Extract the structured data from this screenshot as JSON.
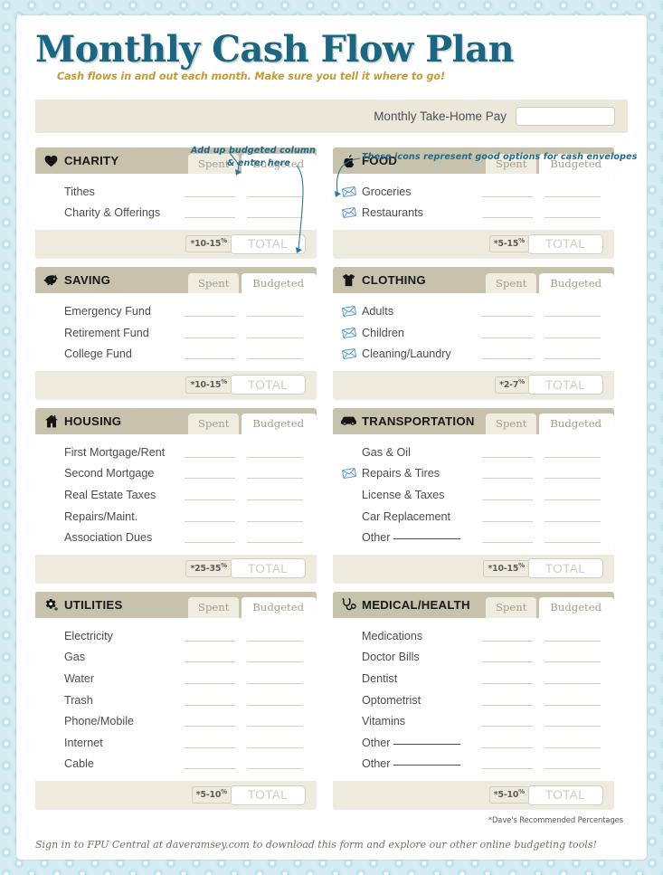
{
  "header": {
    "title": "Monthly Cash Flow Plan",
    "subtitle": "Cash flows in and out each month. Make sure you tell it where to go!",
    "takehome_label": "Monthly Take-Home Pay",
    "takehome_value": ""
  },
  "columns": {
    "spent": "Spent",
    "budgeted": "Budgeted",
    "total": "TOTAL"
  },
  "annotations": {
    "add_up": "Add up budgeted column",
    "enter_here": "& enter here",
    "icons_note": "These icons represent good options for cash envelopes"
  },
  "notes": {
    "recommended": "*Dave's Recommended Percentages",
    "signin": "Sign in to FPU Central at daveramsey.com to download this form and explore our other online budgeting tools!"
  },
  "colors": {
    "title": "#1b6683",
    "subtitle": "#c59a33",
    "header_bar": "#c7c2ab",
    "footer_bar": "#edeade",
    "annotation": "#1f6a8c",
    "background": "#d4ecf2"
  },
  "sections": [
    {
      "name": "CHARITY",
      "icon": "heart-icon",
      "percent": "*10-15",
      "column": "left",
      "items": [
        {
          "label": "Tithes",
          "envelope": false
        },
        {
          "label": "Charity & Offerings",
          "envelope": false
        }
      ]
    },
    {
      "name": "FOOD",
      "icon": "apple-icon",
      "percent": "*5-15",
      "column": "right",
      "items": [
        {
          "label": "Groceries",
          "envelope": true
        },
        {
          "label": "Restaurants",
          "envelope": true
        }
      ]
    },
    {
      "name": "SAVING",
      "icon": "piggy-bank-icon",
      "percent": "*10-15",
      "column": "left",
      "items": [
        {
          "label": "Emergency Fund",
          "envelope": false
        },
        {
          "label": "Retirement Fund",
          "envelope": false
        },
        {
          "label": "College Fund",
          "envelope": false
        }
      ]
    },
    {
      "name": "CLOTHING",
      "icon": "tshirt-icon",
      "percent": "*2-7",
      "column": "right",
      "items": [
        {
          "label": "Adults",
          "envelope": true
        },
        {
          "label": "Children",
          "envelope": true
        },
        {
          "label": "Cleaning/Laundry",
          "envelope": true
        }
      ]
    },
    {
      "name": "HOUSING",
      "icon": "house-icon",
      "percent": "*25-35",
      "column": "left",
      "items": [
        {
          "label": "First Mortgage/Rent",
          "envelope": false
        },
        {
          "label": "Second Mortgage",
          "envelope": false
        },
        {
          "label": "Real Estate Taxes",
          "envelope": false
        },
        {
          "label": "Repairs/Maint.",
          "envelope": false
        },
        {
          "label": "Association Dues",
          "envelope": false
        }
      ]
    },
    {
      "name": "TRANSPORTATION",
      "icon": "car-icon",
      "percent": "*10-15",
      "column": "right",
      "items": [
        {
          "label": "Gas & Oil",
          "envelope": false
        },
        {
          "label": "Repairs & Tires",
          "envelope": true
        },
        {
          "label": "License & Taxes",
          "envelope": false
        },
        {
          "label": "Car Replacement",
          "envelope": false
        },
        {
          "label": "Other",
          "envelope": false,
          "fill_blank": true
        }
      ]
    },
    {
      "name": "UTILITIES",
      "icon": "gear-icon",
      "percent": "*5-10",
      "column": "left",
      "items": [
        {
          "label": "Electricity",
          "envelope": false
        },
        {
          "label": "Gas",
          "envelope": false
        },
        {
          "label": "Water",
          "envelope": false
        },
        {
          "label": "Trash",
          "envelope": false
        },
        {
          "label": "Phone/Mobile",
          "envelope": false
        },
        {
          "label": "Internet",
          "envelope": false
        },
        {
          "label": "Cable",
          "envelope": false
        }
      ]
    },
    {
      "name": "MEDICAL/HEALTH",
      "icon": "stethoscope-icon",
      "percent": "*5-10",
      "column": "right",
      "items": [
        {
          "label": "Medications",
          "envelope": false
        },
        {
          "label": "Doctor Bills",
          "envelope": false
        },
        {
          "label": "Dentist",
          "envelope": false
        },
        {
          "label": "Optometrist",
          "envelope": false
        },
        {
          "label": "Vitamins",
          "envelope": false
        },
        {
          "label": "Other",
          "envelope": false,
          "fill_blank": true
        },
        {
          "label": "Other",
          "envelope": false,
          "fill_blank": true
        }
      ]
    }
  ]
}
